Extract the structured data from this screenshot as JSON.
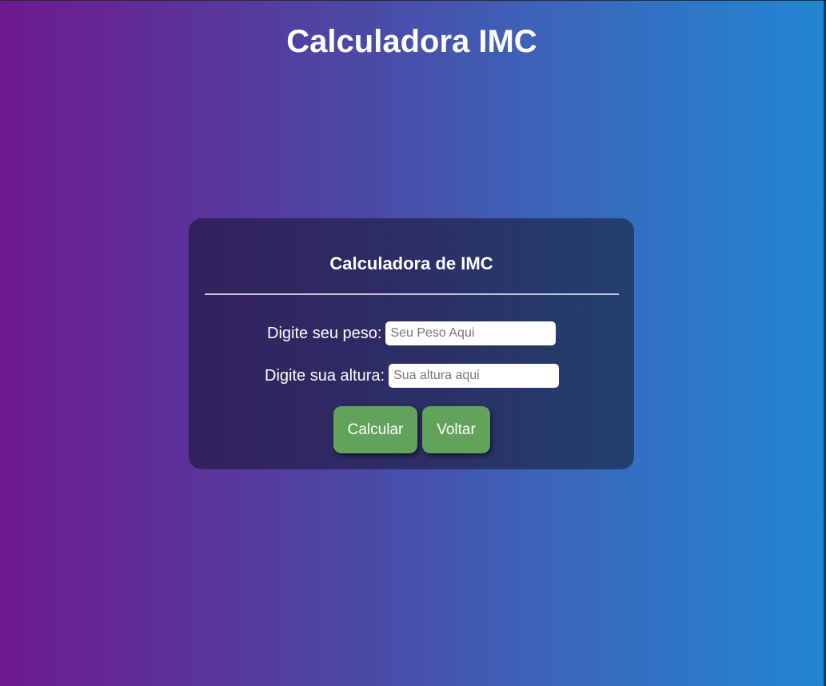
{
  "page": {
    "title": "Calculadora IMC"
  },
  "card": {
    "title": "Calculadora de IMC",
    "weight": {
      "label": "Digite seu peso:",
      "placeholder": "Seu Peso Aqui",
      "value": ""
    },
    "height": {
      "label": "Digite sua altura:",
      "placeholder": "Sua altura aqui",
      "value": ""
    },
    "buttons": {
      "calculate_label": "Calcular",
      "back_label": "Voltar"
    }
  },
  "colors": {
    "gradient_left": "#6d1a8f",
    "gradient_right": "#2187d2",
    "card_bg": "#2c2e65",
    "button_green": "#61a35a"
  }
}
